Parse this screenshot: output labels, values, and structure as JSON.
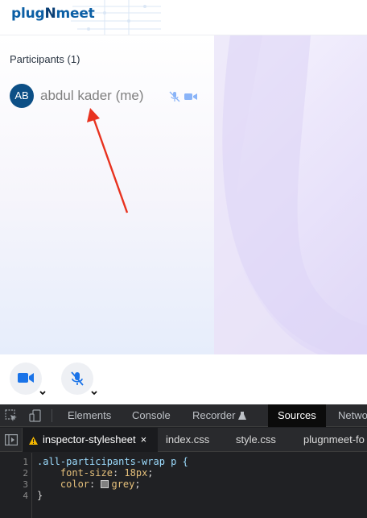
{
  "app": {
    "logo_prefix": "plug",
    "logo_n": "N",
    "logo_suffix": "meet"
  },
  "participants": {
    "title": "Participants (1)",
    "list": [
      {
        "initials": "AB",
        "name": "abdul kader (me)"
      }
    ]
  },
  "colors": {
    "brand": "#0b5fa5",
    "avatar": "#0c4f86",
    "name_grey": "#808080",
    "control_accent": "#1a73e8",
    "arrow": "#e8321f"
  },
  "icons": {
    "participant_mic": "mic-muted-icon",
    "participant_cam": "camera-icon",
    "control_cam": "camera-icon",
    "control_mic": "mic-muted-icon",
    "inspect": "inspect-element-icon",
    "device": "device-toolbar-icon"
  },
  "devtools": {
    "tabs": [
      "Elements",
      "Console",
      "Recorder",
      "Sources",
      "Netwo"
    ],
    "active_tab": "Sources",
    "file_tabs": [
      "inspector-stylesheet",
      "index.css",
      "style.css",
      "plugnmeet-fo"
    ],
    "active_file": "inspector-stylesheet",
    "code": {
      "line_numbers": [
        "1",
        "2",
        "3",
        "4"
      ],
      "selector": ".all-participants-wrap p {",
      "line2_prop": "font-size",
      "line2_value": "18px",
      "line3_prop": "color",
      "line3_value": "grey",
      "line4": "}"
    }
  }
}
